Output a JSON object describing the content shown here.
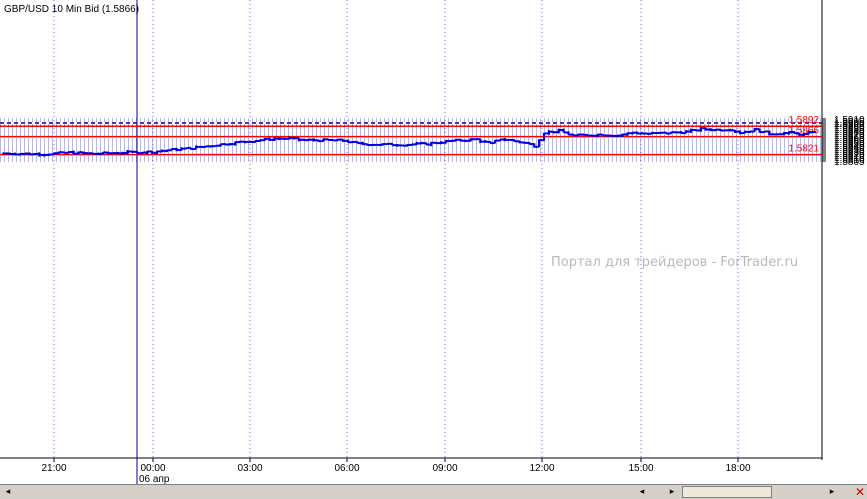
{
  "chart_data": {
    "type": "bar",
    "subtype": "ohlc",
    "title": "GBP/USD 10 Min Bid (1.5866)",
    "watermark": "Портал для трейдеров - ForTrader.ru",
    "y_axis": {
      "position": "right",
      "range": [
        1.58,
        1.5912
      ],
      "ticks": [
        "1.5805",
        "1.5810",
        "1.5815",
        "1.5820",
        "1.5825",
        "1.5830",
        "1.5835",
        "1.5840",
        "1.5845",
        "1.5850",
        "1.5855",
        "1.5860",
        "1.5865",
        "1.5870",
        "1.5875",
        "1.5880",
        "1.5885",
        "1.5890",
        "1.5895",
        "1.5900",
        "1.5905",
        "1.5910"
      ],
      "grid": true
    },
    "x_axis": {
      "ticks": [
        "21:00",
        "00:00",
        "03:00",
        "06:00",
        "09:00",
        "12:00",
        "15:00",
        "18:00"
      ],
      "date_label": "06 апр",
      "grid": true
    },
    "current_price_line": {
      "value": 1.59,
      "label": "1.5900",
      "color": "#000099"
    },
    "levels": [
      {
        "value": 1.5892,
        "label": "1.5892",
        "color": "#ff0000"
      },
      {
        "value": 1.5866,
        "label": "1.5866",
        "color": "#ff0000"
      },
      {
        "value": 1.5821,
        "label": "1.5821",
        "color": "#ff0000"
      }
    ],
    "day_separator": "00:00",
    "series_color": "#0000dd",
    "anchors": [
      [
        0,
        1.5824
      ],
      [
        8,
        1.5822
      ],
      [
        13,
        1.5826
      ],
      [
        18,
        1.5823
      ],
      [
        24,
        1.5826
      ],
      [
        30,
        1.5828
      ],
      [
        34,
        1.5833
      ],
      [
        38,
        1.5837
      ],
      [
        43,
        1.5845
      ],
      [
        47,
        1.5851
      ],
      [
        51,
        1.5856
      ],
      [
        55,
        1.5861
      ],
      [
        58,
        1.5861
      ],
      [
        61,
        1.5857
      ],
      [
        64,
        1.5857
      ],
      [
        69,
        1.5856
      ],
      [
        72,
        1.5848
      ],
      [
        76,
        1.5846
      ],
      [
        82,
        1.5846
      ],
      [
        86,
        1.5848
      ],
      [
        91,
        1.5855
      ],
      [
        96,
        1.5859
      ],
      [
        99,
        1.5848
      ],
      [
        101,
        1.586
      ],
      [
        103,
        1.5857
      ],
      [
        106,
        1.585
      ],
      [
        108,
        1.5843
      ],
      [
        110,
        1.5876
      ],
      [
        113,
        1.588
      ],
      [
        116,
        1.5868
      ],
      [
        119,
        1.587
      ],
      [
        122,
        1.5871
      ],
      [
        125,
        1.5869
      ],
      [
        128,
        1.5876
      ],
      [
        131,
        1.5873
      ],
      [
        135,
        1.5875
      ],
      [
        139,
        1.5878
      ],
      [
        142,
        1.5885
      ],
      [
        145,
        1.5883
      ],
      [
        148,
        1.5884
      ],
      [
        150,
        1.5876
      ],
      [
        153,
        1.5883
      ],
      [
        156,
        1.5873
      ],
      [
        160,
        1.5875
      ],
      [
        163,
        1.5871
      ],
      [
        165,
        1.5879
      ]
    ],
    "bar_count": 166
  },
  "scrollbar": {
    "left_arrow": "◂",
    "right_arrow": "▸",
    "close": "✕"
  }
}
